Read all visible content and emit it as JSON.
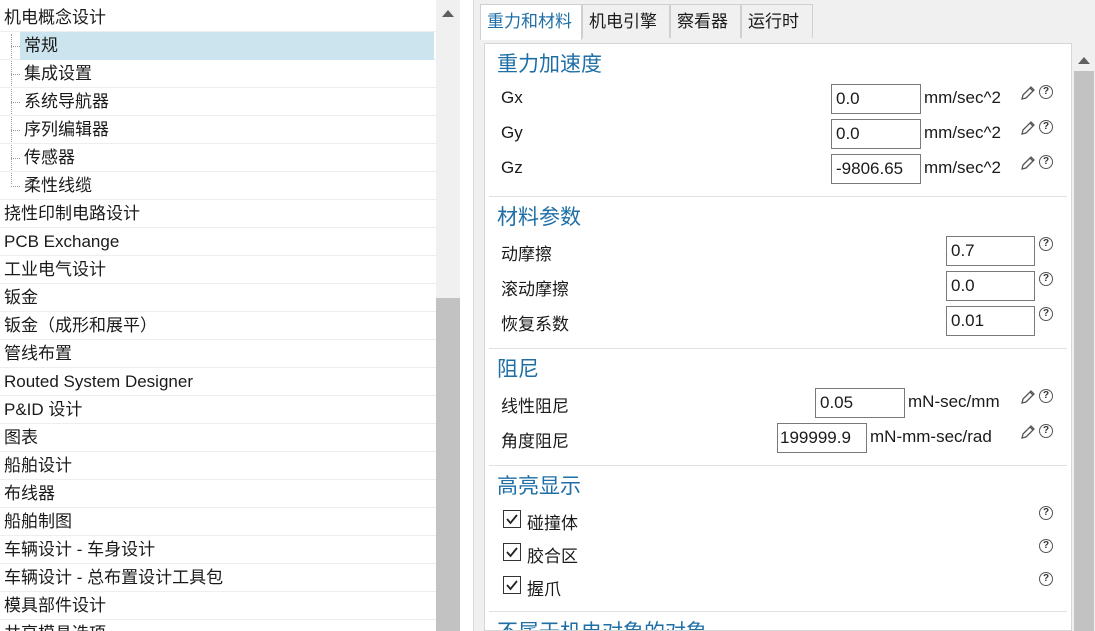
{
  "tree": {
    "items": [
      {
        "label": "机电概念设计"
      },
      {
        "label": "常规"
      },
      {
        "label": "集成设置"
      },
      {
        "label": "系统导航器"
      },
      {
        "label": "序列编辑器"
      },
      {
        "label": "传感器"
      },
      {
        "label": "柔性线缆"
      },
      {
        "label": "挠性印制电路设计"
      },
      {
        "label": "PCB Exchange"
      },
      {
        "label": "工业电气设计"
      },
      {
        "label": "钣金"
      },
      {
        "label": "钣金（成形和展平）"
      },
      {
        "label": "管线布置"
      },
      {
        "label": "Routed System Designer"
      },
      {
        "label": "P&ID 设计"
      },
      {
        "label": "图表"
      },
      {
        "label": "船舶设计"
      },
      {
        "label": "布线器"
      },
      {
        "label": "船舶制图"
      },
      {
        "label": "车辆设计 - 车身设计"
      },
      {
        "label": "车辆设计 - 总布置设计工具包"
      },
      {
        "label": "模具部件设计"
      },
      {
        "label": "共享模具选项"
      }
    ]
  },
  "tabs": [
    "重力和材料",
    "机电引擎",
    "察看器",
    "运行时"
  ],
  "gravity": {
    "title": "重力加速度",
    "rows": [
      {
        "label": "Gx",
        "value": "0.0",
        "unit": "mm/sec^2"
      },
      {
        "label": "Gy",
        "value": "0.0",
        "unit": "mm/sec^2"
      },
      {
        "label": "Gz",
        "value": "-9806.65",
        "unit": "mm/sec^2"
      }
    ]
  },
  "material": {
    "title": "材料参数",
    "rows": [
      {
        "label": "动摩擦",
        "value": "0.7"
      },
      {
        "label": "滚动摩擦",
        "value": "0.0"
      },
      {
        "label": "恢复系数",
        "value": "0.01"
      }
    ]
  },
  "damping": {
    "title": "阻尼",
    "rows": [
      {
        "label": "线性阻尼",
        "value": "0.05",
        "unit": "mN-sec/mm"
      },
      {
        "label": "角度阻尼",
        "value": "199999.9",
        "unit": "mN-mm-sec/rad"
      }
    ]
  },
  "highlight": {
    "title": "高亮显示",
    "items": [
      {
        "label": "碰撞体",
        "checked": true
      },
      {
        "label": "胶合区",
        "checked": true
      },
      {
        "label": "握爪",
        "checked": true
      }
    ]
  },
  "next_section": {
    "title": "不属于机电对象的对象"
  },
  "colors": {
    "accent": "#1f6fa6",
    "selection": "#cce4ee"
  },
  "icons": {
    "edit": "pencil-icon",
    "help": "help-icon",
    "check": "checkmark-icon"
  }
}
